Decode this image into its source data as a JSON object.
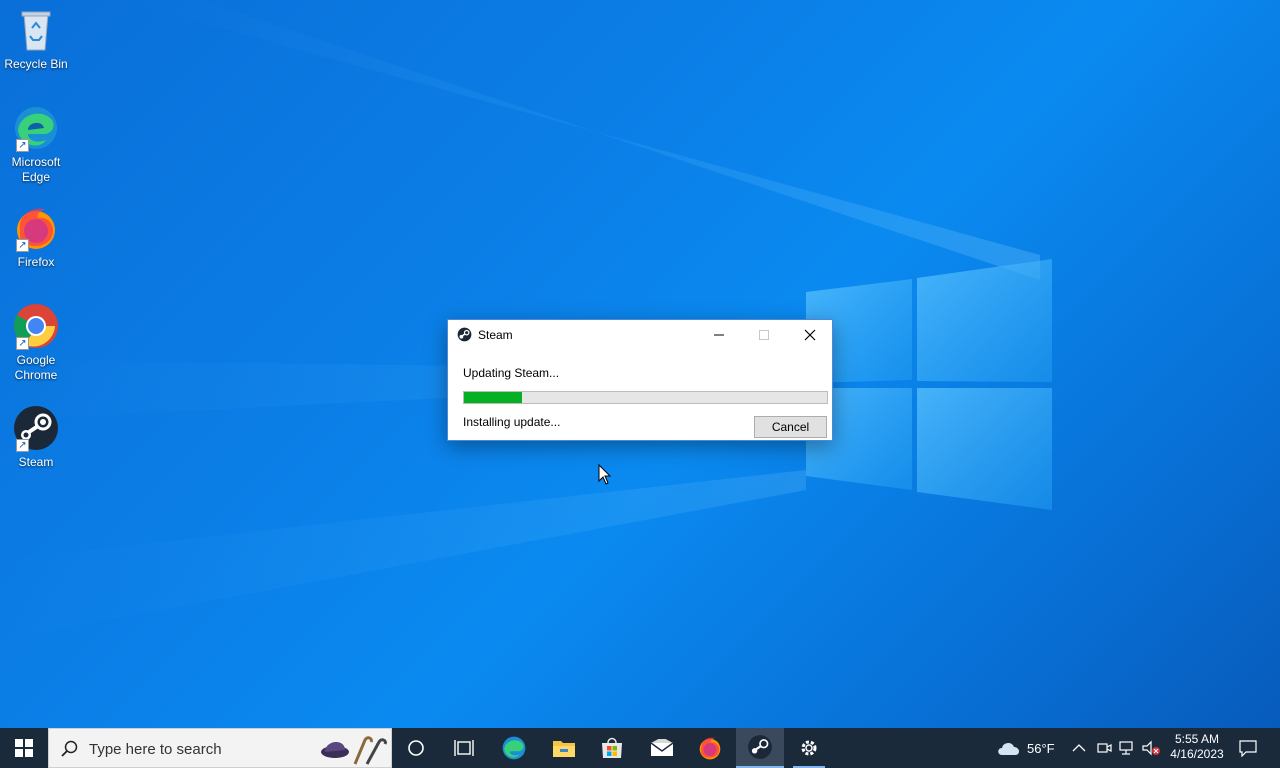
{
  "desktop": {
    "icons": [
      {
        "label": "Recycle Bin",
        "icon": "recycle-bin-icon"
      },
      {
        "label": "Microsoft Edge",
        "icon": "edge-icon"
      },
      {
        "label": "Firefox",
        "icon": "firefox-icon"
      },
      {
        "label": "Google Chrome",
        "icon": "chrome-icon"
      },
      {
        "label": "Steam",
        "icon": "steam-icon"
      }
    ]
  },
  "dialog": {
    "title": "Steam",
    "status": "Updating Steam...",
    "substatus": "Installing update...",
    "progress_fraction": 0.16,
    "cancel_label": "Cancel",
    "progress_color": "#06b025"
  },
  "taskbar": {
    "search_placeholder": "Type here to search",
    "apps": [
      "cortana-icon",
      "task-view-icon",
      "edge-icon",
      "file-explorer-icon",
      "store-icon",
      "mail-icon",
      "firefox-icon",
      "steam-icon",
      "settings-icon"
    ],
    "weather_temp": "56°F",
    "time": "5:55 AM",
    "date": "4/16/2023"
  },
  "colors": {
    "desktop_blue": "#0a7ee6",
    "taskbar": "#1b2a3a",
    "accent": "#7fb7ee"
  }
}
